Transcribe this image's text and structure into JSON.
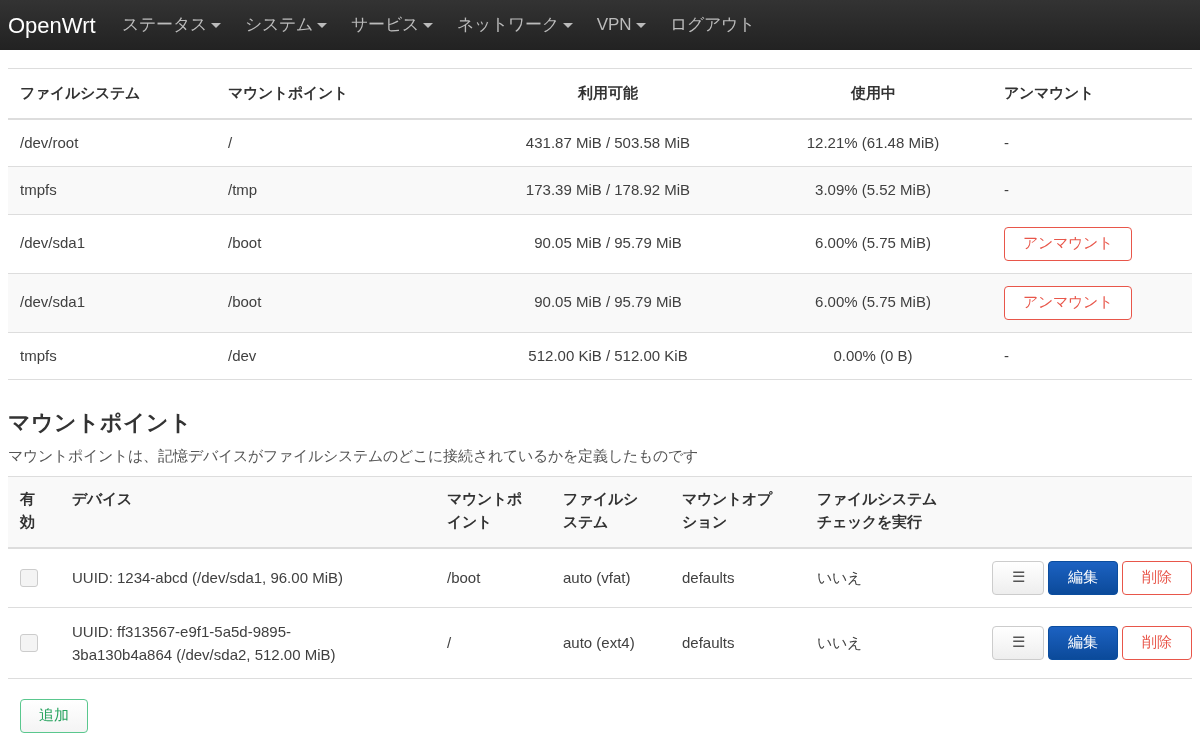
{
  "navbar": {
    "brand": "OpenWrt",
    "menus": [
      {
        "label": "ステータス",
        "dropdown": true
      },
      {
        "label": "システム",
        "dropdown": true
      },
      {
        "label": "サービス",
        "dropdown": true
      },
      {
        "label": "ネットワーク",
        "dropdown": true
      },
      {
        "label": "VPN",
        "dropdown": true
      },
      {
        "label": "ログアウト",
        "dropdown": false
      }
    ]
  },
  "mounted_table": {
    "columns": [
      "ファイルシステム",
      "マウントポイント",
      "利用可能",
      "使用中",
      "アンマウント"
    ],
    "rows": [
      {
        "filesystem": "/dev/root",
        "mount_point": "/",
        "available": "431.87 MiB / 503.58 MiB",
        "used": "12.21% (61.48 MiB)",
        "unmount": {
          "kind": "text",
          "label": "-"
        }
      },
      {
        "filesystem": "tmpfs",
        "mount_point": "/tmp",
        "available": "173.39 MiB / 178.92 MiB",
        "used": "3.09% (5.52 MiB)",
        "unmount": {
          "kind": "text",
          "label": "-"
        }
      },
      {
        "filesystem": "/dev/sda1",
        "mount_point": "/boot",
        "available": "90.05 MiB / 95.79 MiB",
        "used": "6.00% (5.75 MiB)",
        "unmount": {
          "kind": "button",
          "label": "アンマウント"
        }
      },
      {
        "filesystem": "/dev/sda1",
        "mount_point": "/boot",
        "available": "90.05 MiB / 95.79 MiB",
        "used": "6.00% (5.75 MiB)",
        "unmount": {
          "kind": "button",
          "label": "アンマウント"
        }
      },
      {
        "filesystem": "tmpfs",
        "mount_point": "/dev",
        "available": "512.00 KiB / 512.00 KiB",
        "used": "0.00% (0 B)",
        "unmount": {
          "kind": "text",
          "label": "-"
        }
      }
    ]
  },
  "mount_points": {
    "title": "マウントポイント",
    "description": "マウントポイントは、記憶デバイスがファイルシステムのどこに接続されているかを定義したものです",
    "columns": [
      "有効",
      "デバイス",
      "マウントポイント",
      "ファイルシステム",
      "マウントオプション",
      "ファイルシステムチェックを実行"
    ],
    "rows": [
      {
        "enabled": false,
        "device": "UUID: 1234-abcd (/dev/sda1, 96.00 MiB)",
        "mount_point": "/boot",
        "filesystem": "auto (vfat)",
        "options": "defaults",
        "fsck": "いいえ",
        "buttons": [
          "☰",
          "編集",
          "削除"
        ]
      },
      {
        "enabled": false,
        "device": "UUID: ff313567-e9f1-5a5d-9895-3ba130b4a864 (/dev/sda2, 512.00 MiB)",
        "mount_point": "/",
        "filesystem": "auto (ext4)",
        "options": "defaults",
        "fsck": "いいえ",
        "buttons": [
          "☰",
          "編集",
          "削除"
        ]
      }
    ],
    "add_button": "追加"
  }
}
